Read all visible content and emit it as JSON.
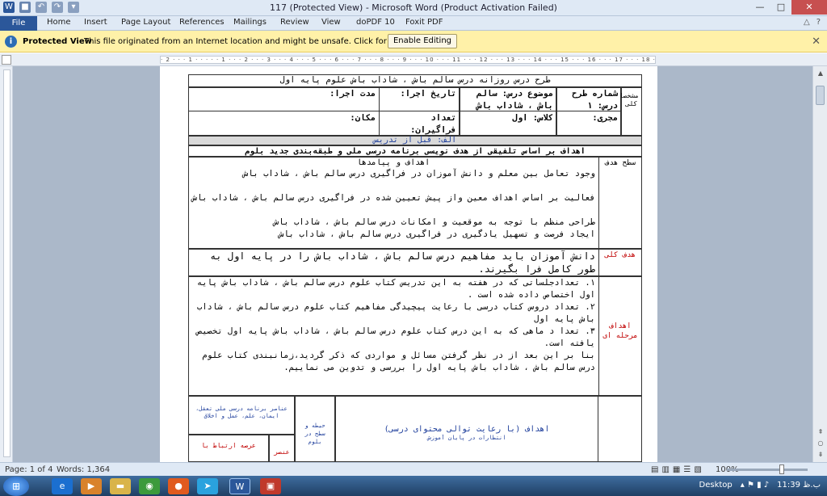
{
  "window": {
    "title": "117 (Protected View) - Microsoft Word (Product Activation Failed)"
  },
  "ribbon": {
    "tabs": [
      "File",
      "Home",
      "Insert",
      "Page Layout",
      "References",
      "Mailings",
      "Review",
      "View",
      "doPDF 10",
      "Foxit PDF"
    ]
  },
  "protected_view": {
    "label": "Protected View",
    "message": "This file originated from an Internet location and might be unsafe. Click for more details.",
    "button": "Enable Editing"
  },
  "ruler": {
    "text": "· 2 · · · 1 · · · · · 1 · · · 2 · · · 3 · · · 4 · · · 5 · · · 6 · · · 7 · · · 8 · · · 9 · · · 10 · · · 11 · · · 12 · · · 13 · · · 14 · · · 15 · · · 16 · · · 17 · · · 18 · · ·"
  },
  "document": {
    "header_title": "طرح درس روزانه درس سالم باش ، شاداب باش علوم پایه اول",
    "side_label": "مشخصات کلی",
    "plan_number": "شماره طرح درس: ۱",
    "subject": "موضوع درس: سالم باش ، شاداب باش",
    "exec_date": "تاریخ اجرا:",
    "duration": "مدت اجرا:",
    "instructor": "مجری:",
    "class_label": "کلاس: اول",
    "learners_count": "تعداد فراگیران:",
    "place": "مکان:",
    "section_a": "الف: قبل از تدریس",
    "objectives_header": "اهداف بر اساس تلفیقی از هدف نویسی برنامه درسی ملی و طبقه‌بندی جدید بلوم",
    "level_goal": "سطح هدف",
    "goals_title": "اهداف و پیامدها",
    "goals_body": [
      "وجود تعامل بین معلم و دانش آموزان در فراگیری درس سالم باش ، شاداب باش",
      "فعالیت بر اساس اهداف معین واز پیش تعیین شده در فراگیری درس سالم باش ، شاداب باش",
      "طراحی منظم با توجه به موقعیت و امکانات درس سالم باش ، شاداب باش",
      "ایجاد فرصت و تسهیل یادگیری در فراگیری درس سالم باش ، شاداب باش"
    ],
    "general_goal_label": "هدف کلی",
    "general_goal": "دانش آموزان باید مفاهیم درس سالم باش ، شاداب باش را در پایه اول به طور کامل فرا بگیرند.",
    "stage_goal_label": "اهداف مرحله ای",
    "stage_goals": [
      "۱.     تعدادجلساتی که در هفته به این تدریس کتاب علوم درس سالم باش ، شاداب باش پایه اول اختصاص داده شده است .",
      "۲.     تعداد دروس کتاب درسی با رعایت پیچیدگی مفاهیم کتاب علوم درس سالم باش ، شاداب باش پایه اول",
      "۳.     تعدا د ماهی که به این درس کتاب علوم درس سالم باش ، شاداب باش پایه اول تخصیص یافته است.",
      "بنا بر این بعد از در نظر گرفتن مسائل و مواردی که ذکر گردید،زمانبندی کتاب علوم درس سالم باش ، شاداب باش پایه اول را بررسی و تدوین می نماییم."
    ],
    "bottom_goals": "اهداف (با رعایت توالی محتوای درسی)",
    "bottom_goals_sub": "انتظارات در پایان آموزش",
    "domain_label": "حیطه و سطح در بلوم",
    "national_elements": "عناصر برنامه درسی ملی تعقل، ایمان، علم، عمل و اخلاق",
    "relation_label": "عرصه ارتباط با",
    "element_label": "عنصر"
  },
  "status": {
    "page": "Page: 1 of 4",
    "words": "Words: 1,364",
    "zoom": "100%"
  },
  "taskbar": {
    "desktop": "Desktop",
    "time": "11:39 ب.ظ"
  },
  "colors": {
    "file_tab": "#2b579a",
    "warning_bar": "#fff1a8",
    "accent_red": "#c00000",
    "blue_text": "#1f3f9c"
  }
}
